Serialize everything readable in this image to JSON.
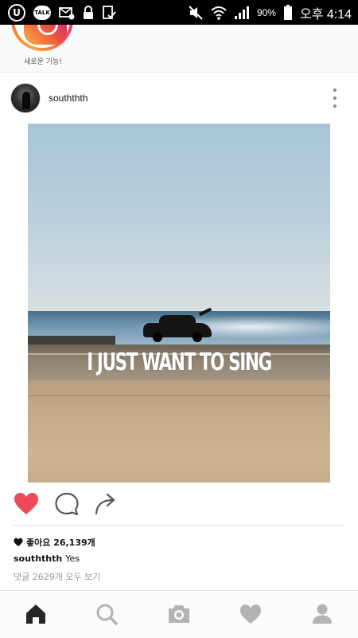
{
  "status_bar": {
    "battery": "90%",
    "time": "오후 4:14",
    "icons": [
      "u-plus-icon",
      "kakaotalk-icon",
      "mail-icon",
      "lock-icon",
      "checklist-icon",
      "mute-icon",
      "wifi-icon",
      "signal-icon",
      "battery-icon"
    ]
  },
  "story": {
    "caption": "새로운 기능!",
    "icon": "instagram-logo"
  },
  "post": {
    "username": "souththth",
    "image_text": "I JUST WANT TO SING",
    "likes": "좋아요 26,139개",
    "caption_user": "souththth",
    "caption_text": "Yes",
    "comments": "댓글 2629개 모두 보기"
  },
  "actions": {
    "like_icon": "heart-filled-icon",
    "comment_icon": "comment-icon",
    "share_icon": "share-icon"
  },
  "nav": [
    "home-icon",
    "search-icon",
    "camera-icon",
    "heart-icon",
    "profile-icon"
  ],
  "colors": {
    "like_red": "#ed4956",
    "nav_active": "#262626",
    "nav_inactive": "#b3b3b3"
  }
}
